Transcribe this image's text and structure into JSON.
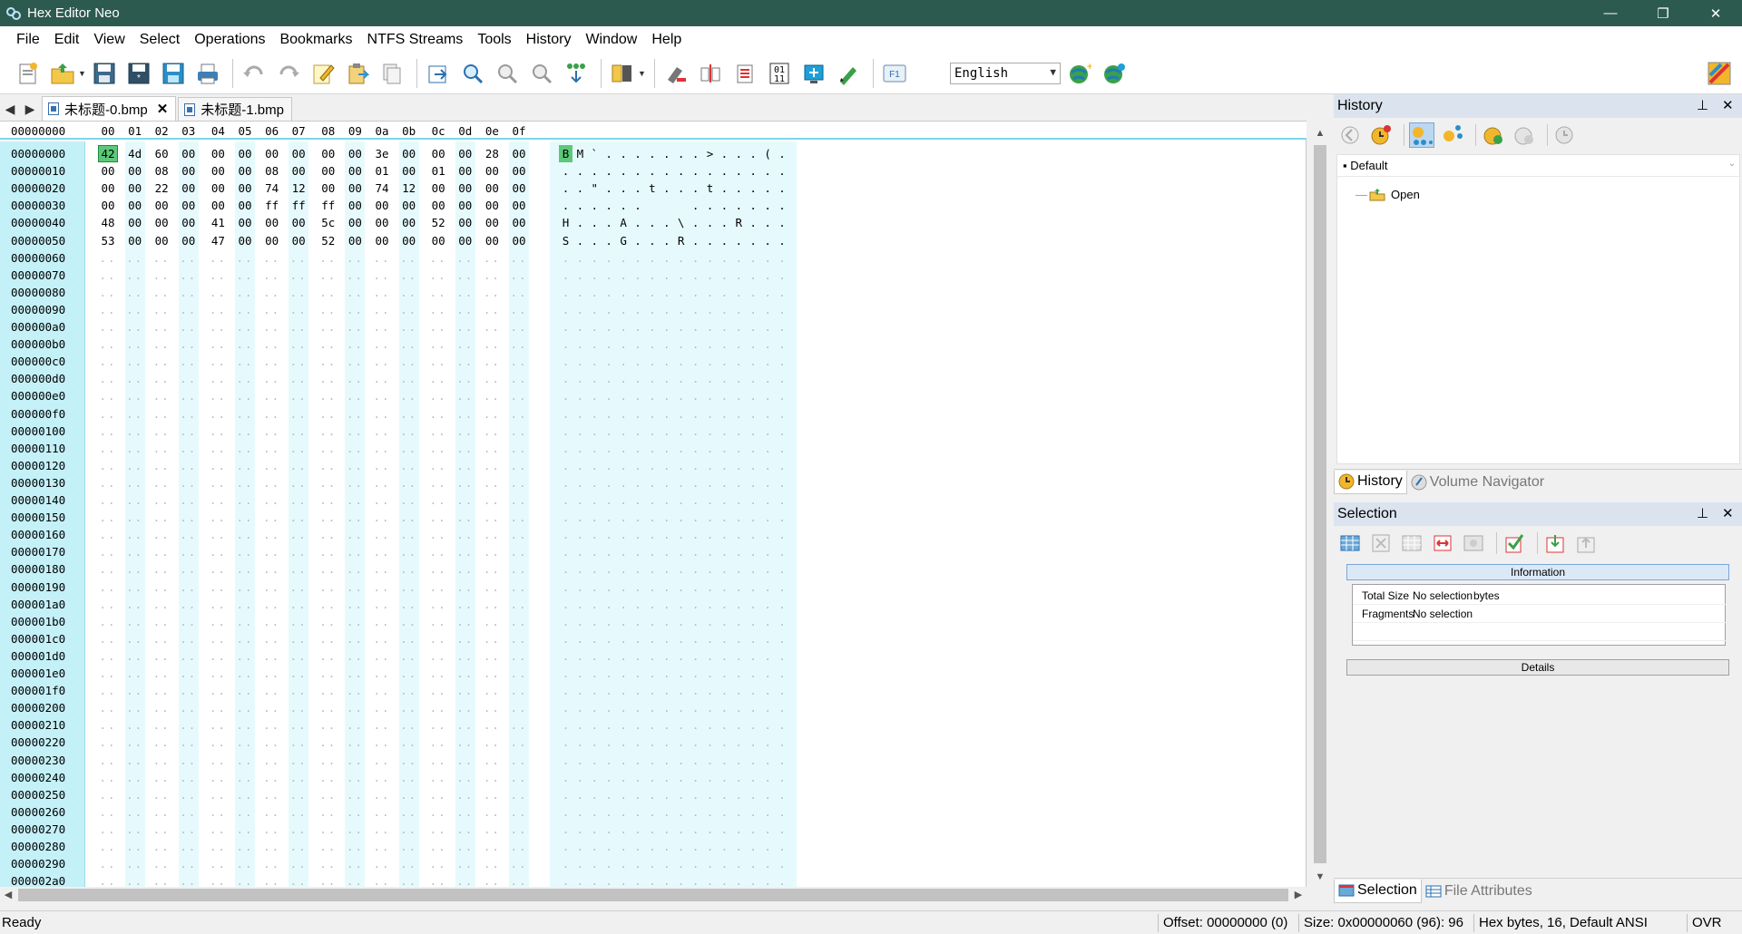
{
  "window": {
    "title": "Hex Editor Neo",
    "minimize": "—",
    "restore": "❐",
    "close": "✕"
  },
  "menu": [
    "File",
    "Edit",
    "View",
    "Select",
    "Operations",
    "Bookmarks",
    "NTFS Streams",
    "Tools",
    "History",
    "Window",
    "Help"
  ],
  "toolbar": {
    "language": "English"
  },
  "tabs": [
    {
      "label": "未标题-0.bmp",
      "active": true,
      "close": "✕"
    },
    {
      "label": "未标题-1.bmp",
      "active": false
    }
  ],
  "hex": {
    "header_offset": "00000000",
    "columns": [
      "00",
      "01",
      "02",
      "03",
      "04",
      "05",
      "06",
      "07",
      "08",
      "09",
      "0a",
      "0b",
      "0c",
      "0d",
      "0e",
      "0f"
    ],
    "offsets": [
      "00000000",
      "00000010",
      "00000020",
      "00000030",
      "00000040",
      "00000050",
      "00000060",
      "00000070",
      "00000080",
      "00000090",
      "000000a0",
      "000000b0",
      "000000c0",
      "000000d0",
      "000000e0",
      "000000f0",
      "00000100",
      "00000110",
      "00000120",
      "00000130",
      "00000140",
      "00000150",
      "00000160",
      "00000170",
      "00000180",
      "00000190",
      "000001a0",
      "000001b0",
      "000001c0",
      "000001d0",
      "000001e0",
      "000001f0",
      "00000200",
      "00000210",
      "00000220",
      "00000230",
      "00000240",
      "00000250",
      "00000260",
      "00000270",
      "00000280",
      "00000290",
      "000002a0"
    ],
    "rows": [
      [
        "42",
        "4d",
        "60",
        "00",
        "00",
        "00",
        "00",
        "00",
        "00",
        "00",
        "3e",
        "00",
        "00",
        "00",
        "28",
        "00"
      ],
      [
        "00",
        "00",
        "08",
        "00",
        "00",
        "00",
        "08",
        "00",
        "00",
        "00",
        "01",
        "00",
        "01",
        "00",
        "00",
        "00"
      ],
      [
        "00",
        "00",
        "22",
        "00",
        "00",
        "00",
        "74",
        "12",
        "00",
        "00",
        "74",
        "12",
        "00",
        "00",
        "00",
        "00"
      ],
      [
        "00",
        "00",
        "00",
        "00",
        "00",
        "00",
        "ff",
        "ff",
        "ff",
        "00",
        "00",
        "00",
        "00",
        "00",
        "00",
        "00"
      ],
      [
        "48",
        "00",
        "00",
        "00",
        "41",
        "00",
        "00",
        "00",
        "5c",
        "00",
        "00",
        "00",
        "52",
        "00",
        "00",
        "00"
      ],
      [
        "53",
        "00",
        "00",
        "00",
        "47",
        "00",
        "00",
        "00",
        "52",
        "00",
        "00",
        "00",
        "00",
        "00",
        "00",
        "00"
      ]
    ],
    "ascii": [
      [
        "B",
        "M",
        "`",
        ".",
        ".",
        ".",
        ".",
        ".",
        ".",
        ".",
        ">",
        ".",
        ".",
        ".",
        "(",
        "."
      ],
      [
        ".",
        ".",
        ".",
        ".",
        ".",
        ".",
        ".",
        ".",
        ".",
        ".",
        ".",
        ".",
        ".",
        ".",
        ".",
        "."
      ],
      [
        ".",
        ".",
        "\"",
        ".",
        ".",
        ".",
        "t",
        ".",
        ".",
        ".",
        "t",
        ".",
        ".",
        ".",
        ".",
        "."
      ],
      [
        ".",
        ".",
        ".",
        ".",
        ".",
        ".",
        "",
        "",
        "",
        ".",
        ".",
        ".",
        ".",
        ".",
        ".",
        "."
      ],
      [
        "H",
        ".",
        ".",
        ".",
        "A",
        ".",
        ".",
        ".",
        "\\",
        ".",
        ".",
        ".",
        "R",
        ".",
        ".",
        "."
      ],
      [
        "S",
        ".",
        ".",
        ".",
        "G",
        ".",
        ".",
        ".",
        "R",
        ".",
        ".",
        ".",
        ".",
        ".",
        ".",
        "."
      ]
    ],
    "empty_hex": "..",
    "empty_ascii": "."
  },
  "history_panel": {
    "title": "History",
    "pin": "⊥",
    "close": "✕",
    "branch": "Default",
    "entry": "Open",
    "tab_history": "History",
    "tab_volume": "Volume Navigator"
  },
  "selection_panel": {
    "title": "Selection",
    "pin": "⊥",
    "close": "✕",
    "info_header": "Information",
    "rows": [
      {
        "label": "Total Size",
        "value": "No selection",
        "unit": "bytes"
      },
      {
        "label": "Fragments",
        "value": "No selection",
        "unit": ""
      }
    ],
    "details": "Details",
    "tab_selection": "Selection",
    "tab_attributes": "File Attributes"
  },
  "status": {
    "ready": "Ready",
    "offset": "Offset: 00000000 (0)",
    "size": "Size: 0x00000060 (96): 96",
    "mode": "Hex bytes, 16, Default ANSI",
    "ovr": "OVR"
  },
  "colors": {
    "titlebar": "#2d5a4e",
    "offset_bg": "#c4f0f8",
    "stripe": "#e6fafd",
    "selection": "#5cc87a",
    "panel_head": "#dbe4ee"
  }
}
